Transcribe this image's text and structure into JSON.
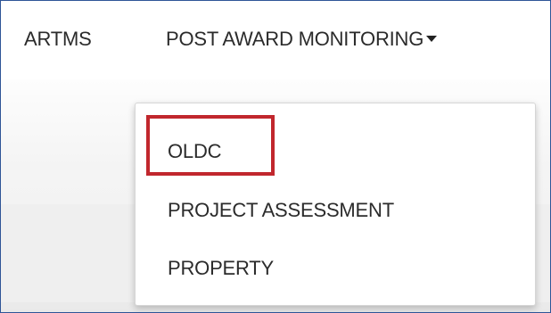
{
  "navbar": {
    "items": [
      {
        "label": "ARTMS"
      },
      {
        "label": "POST AWARD MONITORING"
      }
    ],
    "dropdown_icon": "caret-down-icon"
  },
  "dropdown": {
    "items": [
      {
        "label": "OLDC",
        "highlighted": true
      },
      {
        "label": "PROJECT ASSESSMENT"
      },
      {
        "label": "PROPERTY"
      }
    ]
  },
  "colors": {
    "frame_border": "#2f5597",
    "highlight": "#c1272d",
    "text": "#2b2b2b"
  }
}
